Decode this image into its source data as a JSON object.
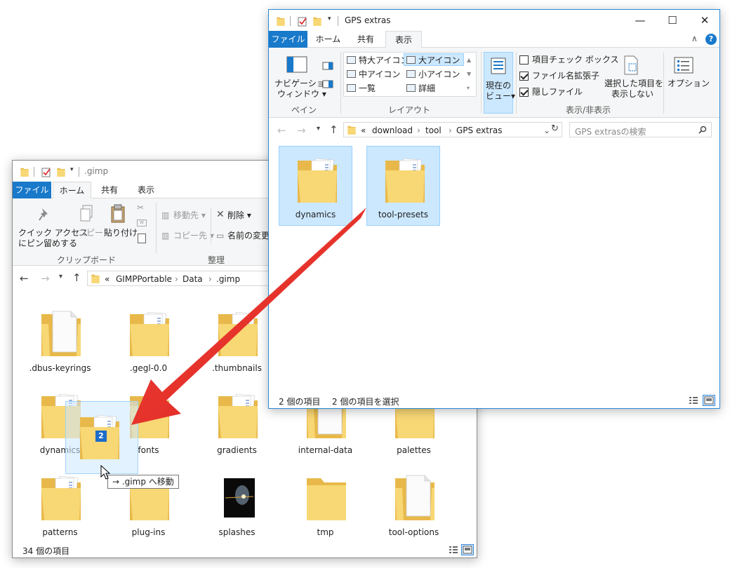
{
  "gimp_window": {
    "title": ".gimp",
    "tabs": [
      "ファイル",
      "ホーム",
      "共有",
      "表示"
    ],
    "ribbon": {
      "pin_label_1": "クイック アクセス",
      "pin_label_2": "にピン留めする",
      "copy_label": "コピー",
      "paste_label": "貼り付け",
      "move_to_label": "移動先",
      "copy_to_label": "コピー先",
      "delete_label": "削除",
      "rename_label": "名前の変更",
      "clipboard_group": "クリップボード",
      "organize_group": "整理"
    },
    "breadcrumb": [
      "«",
      "GIMPPortable",
      "Data",
      ".gimp"
    ],
    "items": [
      {
        "name": ".dbus-keyrings",
        "icon": "folder-doc-icon"
      },
      {
        "name": ".gegl-0.0",
        "icon": "folder-docs-icon"
      },
      {
        "name": ".thumbnails",
        "icon": "folder-docs-icon"
      },
      {
        "name": "dynamics",
        "icon": "folder-docs-icon"
      },
      {
        "name": "fonts",
        "icon": "folder-docs-icon"
      },
      {
        "name": "gradients",
        "icon": "folder-docs-icon"
      },
      {
        "name": "internal-data",
        "icon": "folder-doc-icon"
      },
      {
        "name": "palettes",
        "icon": "folder-docs-icon"
      },
      {
        "name": "patterns",
        "icon": "folder-docs-icon"
      },
      {
        "name": "plug-ins",
        "icon": "folder-docs-icon"
      },
      {
        "name": "splashes",
        "icon": "image-icon"
      },
      {
        "name": "tmp",
        "icon": "folder-icon"
      },
      {
        "name": "tool-options",
        "icon": "folder-doc-icon"
      }
    ],
    "status": "34 個の項目"
  },
  "gps_window": {
    "title": "GPS extras",
    "tabs": [
      "ファイル",
      "ホーム",
      "共有",
      "表示"
    ],
    "ribbon": {
      "nav_pane_1": "ナビゲーション",
      "nav_pane_2": "ウィンドウ",
      "pane_group": "ペイン",
      "layout_options": [
        "特大アイコン",
        "大アイコン",
        "中アイコン",
        "小アイコン",
        "一覧",
        "詳細"
      ],
      "layout_selected": "大アイコン",
      "layout_group": "レイアウト",
      "current_view_1": "現在の",
      "current_view_2": "ビュー",
      "checkboxes": [
        {
          "label": "項目チェック ボックス",
          "checked": false
        },
        {
          "label": "ファイル名拡張子",
          "checked": true
        },
        {
          "label": "隠しファイル",
          "checked": true
        }
      ],
      "hide_selected_1": "選択した項目を",
      "hide_selected_2": "表示しない",
      "show_hide_group": "表示/非表示",
      "options_label": "オプション"
    },
    "breadcrumb": [
      "«",
      "download",
      "tool",
      "GPS extras"
    ],
    "search_placeholder": "GPS extrasの検索",
    "items": [
      {
        "name": "dynamics",
        "selected": true
      },
      {
        "name": "tool-presets",
        "selected": true
      }
    ],
    "status_count": "2 個の項目",
    "status_selected": "2 個の項目を選択"
  },
  "drag": {
    "count": "2",
    "tooltip": "→ .gimp へ移動"
  },
  "colors": {
    "accent": "#1979ca",
    "selection": "#cce8ff",
    "arrow": "#e8302a",
    "folder": "#f8d775"
  }
}
